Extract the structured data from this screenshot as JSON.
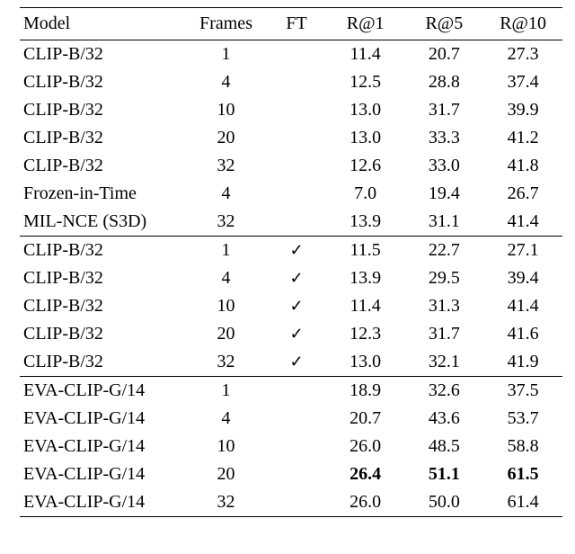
{
  "headers": {
    "model": "Model",
    "frames": "Frames",
    "ft": "FT",
    "r1": "R@1",
    "r5": "R@5",
    "r10": "R@10"
  },
  "check_glyph": "✓",
  "groups": [
    {
      "rows": [
        {
          "model": "CLIP-B/32",
          "frames": "1",
          "ft": false,
          "r1": "11.4",
          "r5": "20.7",
          "r10": "27.3"
        },
        {
          "model": "CLIP-B/32",
          "frames": "4",
          "ft": false,
          "r1": "12.5",
          "r5": "28.8",
          "r10": "37.4"
        },
        {
          "model": "CLIP-B/32",
          "frames": "10",
          "ft": false,
          "r1": "13.0",
          "r5": "31.7",
          "r10": "39.9"
        },
        {
          "model": "CLIP-B/32",
          "frames": "20",
          "ft": false,
          "r1": "13.0",
          "r5": "33.3",
          "r10": "41.2"
        },
        {
          "model": "CLIP-B/32",
          "frames": "32",
          "ft": false,
          "r1": "12.6",
          "r5": "33.0",
          "r10": "41.8"
        },
        {
          "model": "Frozen-in-Time",
          "frames": "4",
          "ft": false,
          "r1": "7.0",
          "r5": "19.4",
          "r10": "26.7"
        },
        {
          "model": "MIL-NCE (S3D)",
          "frames": "32",
          "ft": false,
          "r1": "13.9",
          "r5": "31.1",
          "r10": "41.4"
        }
      ]
    },
    {
      "rows": [
        {
          "model": "CLIP-B/32",
          "frames": "1",
          "ft": true,
          "r1": "11.5",
          "r5": "22.7",
          "r10": "27.1"
        },
        {
          "model": "CLIP-B/32",
          "frames": "4",
          "ft": true,
          "r1": "13.9",
          "r5": "29.5",
          "r10": "39.4"
        },
        {
          "model": "CLIP-B/32",
          "frames": "10",
          "ft": true,
          "r1": "11.4",
          "r5": "31.3",
          "r10": "41.4"
        },
        {
          "model": "CLIP-B/32",
          "frames": "20",
          "ft": true,
          "r1": "12.3",
          "r5": "31.7",
          "r10": "41.6"
        },
        {
          "model": "CLIP-B/32",
          "frames": "32",
          "ft": true,
          "r1": "13.0",
          "r5": "32.1",
          "r10": "41.9"
        }
      ]
    },
    {
      "rows": [
        {
          "model": "EVA-CLIP-G/14",
          "frames": "1",
          "ft": false,
          "r1": "18.9",
          "r5": "32.6",
          "r10": "37.5"
        },
        {
          "model": "EVA-CLIP-G/14",
          "frames": "4",
          "ft": false,
          "r1": "20.7",
          "r5": "43.6",
          "r10": "53.7"
        },
        {
          "model": "EVA-CLIP-G/14",
          "frames": "10",
          "ft": false,
          "r1": "26.0",
          "r5": "48.5",
          "r10": "58.8"
        },
        {
          "model": "EVA-CLIP-G/14",
          "frames": "20",
          "ft": false,
          "r1": "26.4",
          "r5": "51.1",
          "r10": "61.5",
          "bold": [
            "r1",
            "r5",
            "r10"
          ]
        },
        {
          "model": "EVA-CLIP-G/14",
          "frames": "32",
          "ft": false,
          "r1": "26.0",
          "r5": "50.0",
          "r10": "61.4"
        }
      ]
    }
  ],
  "caption_visible": ""
}
